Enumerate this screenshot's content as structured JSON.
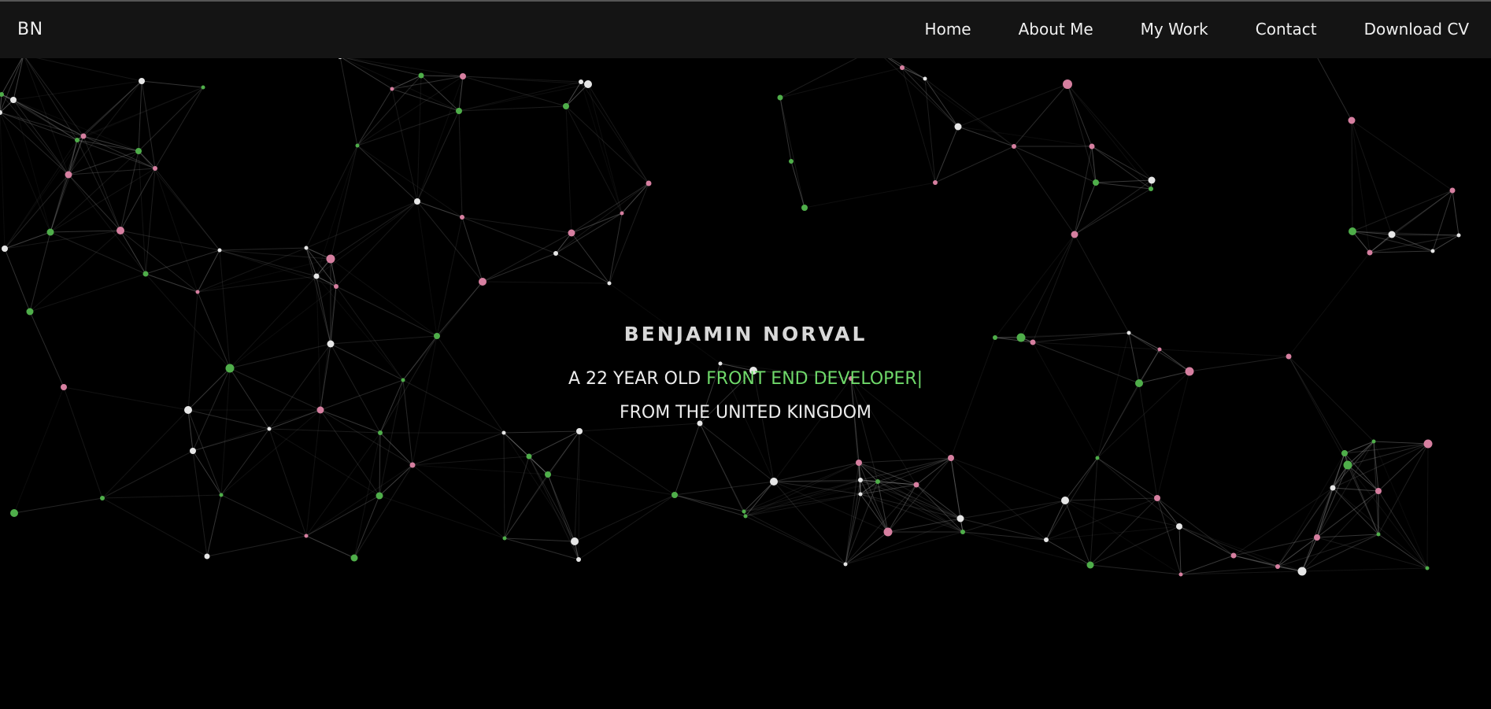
{
  "nav": {
    "brand": "BN",
    "links": [
      {
        "label": "Home"
      },
      {
        "label": "About Me"
      },
      {
        "label": "My Work"
      },
      {
        "label": "Contact"
      },
      {
        "label": "Download CV"
      }
    ]
  },
  "hero": {
    "name": "BENJAMIN NORVAL",
    "line1_prefix": "A 22 YEAR OLD ",
    "line1_highlight": "FRONT END DEVELOPER",
    "cursor": "|",
    "line2": "FROM THE UNITED KINGDOM"
  },
  "colors": {
    "background": "#000000",
    "navbar": "#141414",
    "accent_green": "#6fd86a",
    "node_green": "#4fae4a",
    "node_pink": "#d67fa0",
    "node_white": "#e6e6e6",
    "link_line": "#8a8a8a"
  }
}
